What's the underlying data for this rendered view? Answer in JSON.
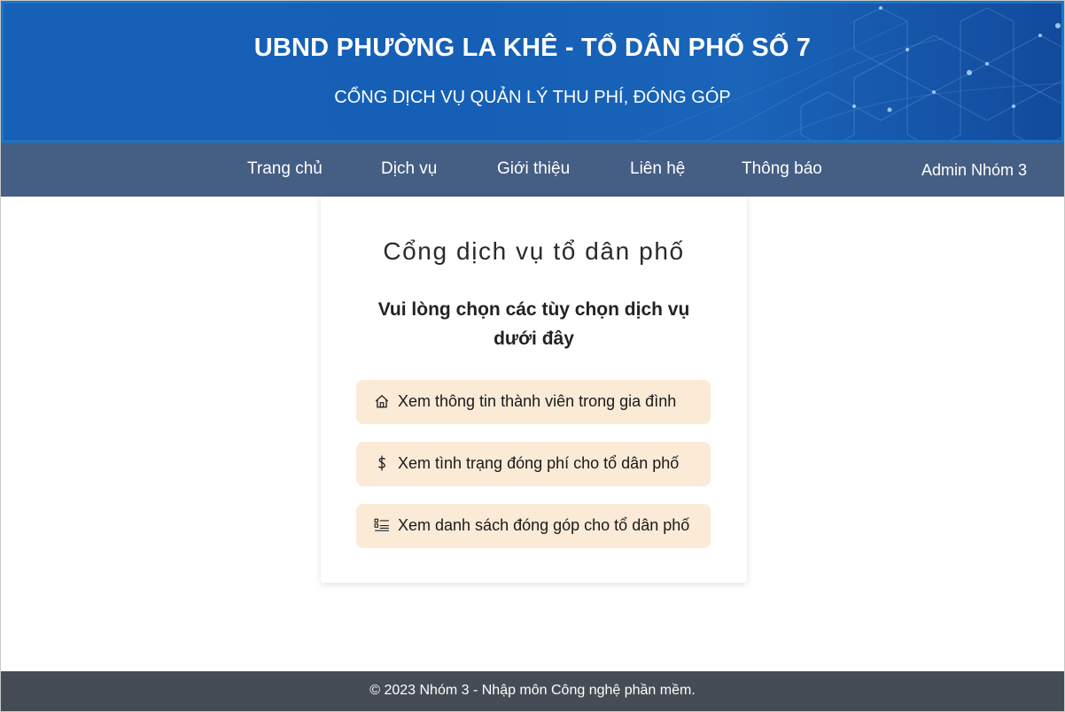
{
  "header": {
    "title": "UBND PHƯỜNG LA KHÊ - TỔ DÂN PHỐ SỐ 7",
    "subtitle": "CỔNG DỊCH VỤ QUẢN LÝ THU PHÍ, ĐÓNG GÓP"
  },
  "nav": {
    "items": [
      {
        "label": "Trang chủ"
      },
      {
        "label": "Dịch vụ"
      },
      {
        "label": "Giới thiệu"
      },
      {
        "label": "Liên hệ"
      },
      {
        "label": "Thông báo"
      }
    ],
    "user_label": "Admin Nhóm 3"
  },
  "card": {
    "title": "Cổng dịch vụ tổ dân phố",
    "subtitle": "Vui lòng chọn các tùy chọn dịch vụ dưới đây",
    "options": [
      {
        "label": "Xem thông tin thành viên trong gia đình",
        "icon": "house-icon"
      },
      {
        "label": "Xem tình trạng đóng phí cho tổ dân phố",
        "icon": "dollar-icon"
      },
      {
        "label": "Xem danh sách đóng góp cho tổ dân phố",
        "icon": "list-icon"
      }
    ]
  },
  "footer": {
    "text": "© 2023 Nhóm 3 - Nhập môn Công nghệ phần mềm."
  },
  "colors": {
    "banner": "#1660b8",
    "navbar": "#455e84",
    "option_bg": "#faead6",
    "footer": "#454c56"
  }
}
